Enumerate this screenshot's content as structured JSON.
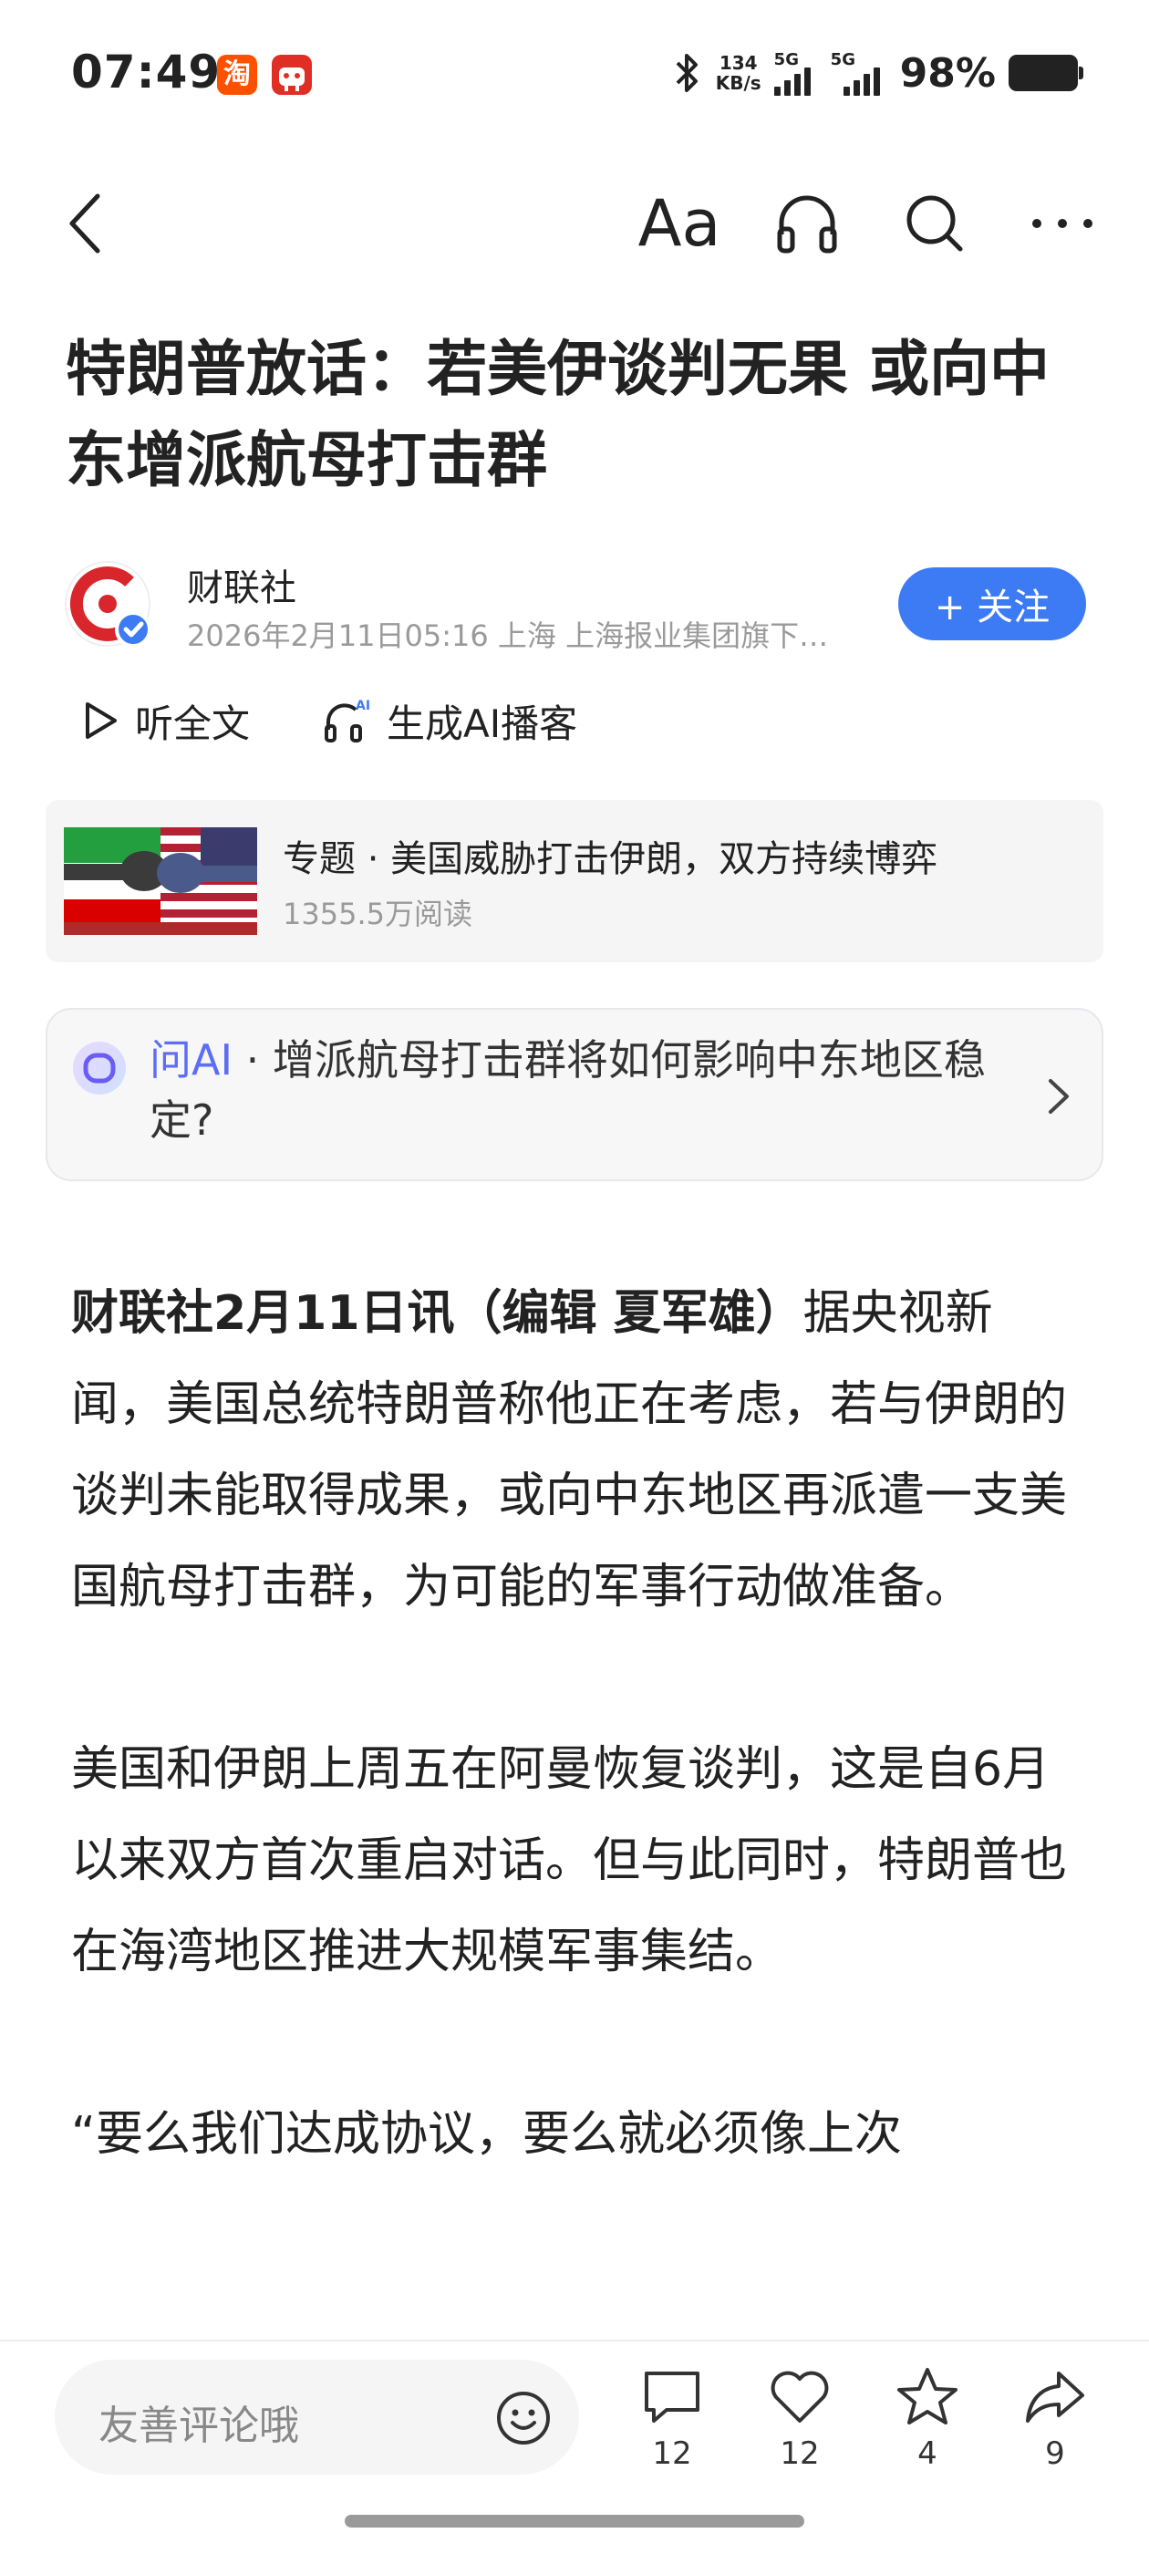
{
  "status_bar": {
    "time": "07:49",
    "taobao_badge": "淘",
    "net_speed_value": "134",
    "net_speed_unit": "KB/s",
    "signal_1": "5G",
    "signal_2": "5G",
    "battery": "98%"
  },
  "toolbar": {
    "font_label": "Aa",
    "icons": [
      "back-icon",
      "font-size-icon",
      "headphones-icon",
      "search-icon",
      "more-icon"
    ]
  },
  "article": {
    "title": "特朗普放话：若美伊谈判无果 或向中东增派航母打击群",
    "author": "财联社",
    "meta": "2026年2月11日05:16 上海 上海报业集团旗下…",
    "follow_label": "+ 关注",
    "listen_label": "听全文",
    "podcast_label": "生成AI播客",
    "lead_bold": "财联社2月11日讯（编辑 夏军雄）",
    "para1_rest": "据央视新闻，美国总统特朗普称他正在考虑，若与伊朗的谈判未能取得成果，或向中东地区再派遣一支美国航母打击群，为可能的军事行动做准备。",
    "para2": "美国和伊朗上周五在阿曼恢复谈判，这是自6月以来双方首次重启对话。但与此同时，特朗普也在海湾地区推进大规模军事集结。",
    "para3": "“要么我们达成协议，要么就必须像上次"
  },
  "topic": {
    "title": "专题 · 美国威胁打击伊朗，双方持续博弈",
    "reads": "1355.5万阅读"
  },
  "ask_ai": {
    "brand": "问AI",
    "question": " · 增派航母打击群将如何影响中东地区稳定?"
  },
  "bottom": {
    "comment_placeholder": "友善评论哦",
    "comments": "12",
    "likes": "12",
    "favorites": "4",
    "shares": "9"
  },
  "colors": {
    "accent": "#3d7bf5",
    "ai_brand": "#5b6ef5",
    "logo_red": "#d9262c"
  }
}
